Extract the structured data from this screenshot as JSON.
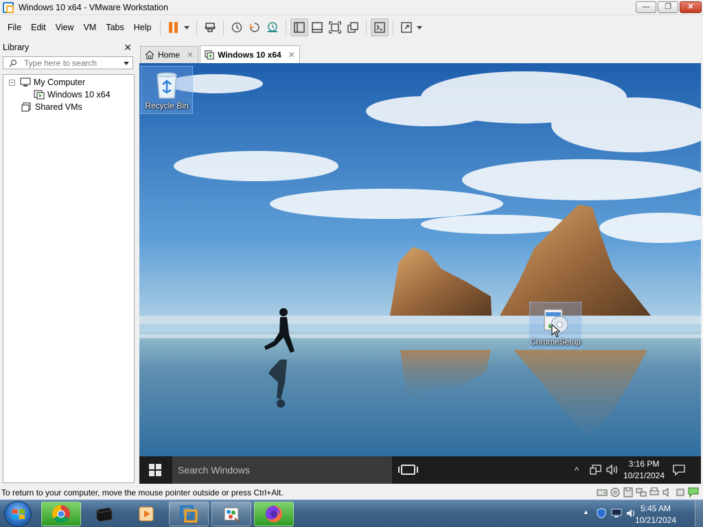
{
  "window": {
    "title": "Windows 10 x64 - VMware Workstation",
    "minimize_glyph": "—",
    "maximize_glyph": "❐",
    "close_glyph": "✕"
  },
  "menu": [
    "File",
    "Edit",
    "View",
    "VM",
    "Tabs",
    "Help"
  ],
  "toolbar": {
    "icons": [
      "pause-icon",
      "send-ctrl-alt-del-icon",
      "snapshot-icon",
      "revert-snapshot-icon",
      "snapshot-manager-icon",
      "show-library-icon",
      "thumbnail-bar-icon",
      "full-screen-icon",
      "unity-icon",
      "console-view-icon",
      "stretch-guest-icon"
    ]
  },
  "library": {
    "title": "Library",
    "close_glyph": "✕",
    "search_placeholder": "Type here to search",
    "tree": [
      {
        "label": "My Computer",
        "expander": "−"
      },
      {
        "label": "Windows 10 x64"
      },
      {
        "label": "Shared VMs"
      }
    ]
  },
  "tabs": [
    {
      "label": "Home",
      "close_glyph": "✕"
    },
    {
      "label": "Windows 10 x64",
      "close_glyph": "✕"
    }
  ],
  "guest": {
    "desktop_icons": [
      {
        "label": "Recycle Bin"
      },
      {
        "label": "ChromeSetup"
      }
    ],
    "taskbar": {
      "search_placeholder": "Search Windows",
      "tray_caret": "^",
      "time": "3:16 PM",
      "date": "10/21/2024"
    }
  },
  "status": {
    "message": "To return to your computer, move the mouse pointer outside or press Ctrl+Alt."
  },
  "host": {
    "apps": [
      "chrome-icon",
      "terminal-icon",
      "media-player-icon",
      "vmware-icon",
      "paint-icon",
      "firefox-icon"
    ],
    "tray_caret": "▲",
    "time": "5:45 AM",
    "date": "10/21/2024"
  },
  "colors": {
    "pause_accent": "#f07a1a",
    "guest_taskbar": "#1d1d1d",
    "host_taskbar": "#3f6387"
  }
}
